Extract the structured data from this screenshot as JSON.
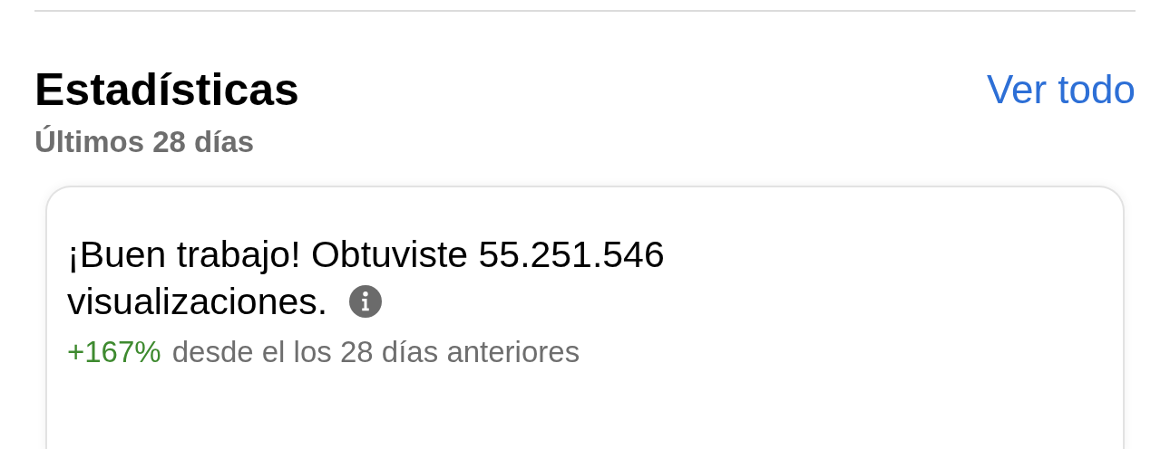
{
  "section": {
    "title": "Estadísticas",
    "link": "Ver todo",
    "subtitle": "Últimos 28 días"
  },
  "card": {
    "headline_lines": [
      "¡Buen trabajo! Obtuviste 55.251.546",
      "visualizaciones."
    ],
    "change": "+167%",
    "change_caption": "desde el los 28 días anteriores"
  }
}
